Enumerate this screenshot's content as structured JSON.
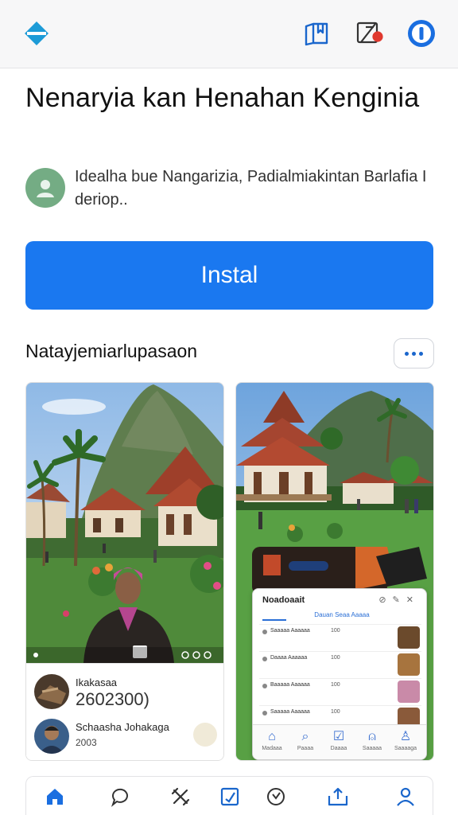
{
  "header": {
    "logo": "diamond-logo-icon",
    "icons": [
      "bookmark-icon",
      "edit-notification-icon",
      "info-icon"
    ]
  },
  "app": {
    "title": "Nenaryia kan Henahan Kenginia",
    "author_text": "Idealha bue Nangarizia, Padialmiakintan Barlafia I deriop..",
    "install_label": "Instal"
  },
  "screenshots": {
    "section_title": "Natayjemiarlupasaon",
    "card1": {
      "row1_name": "Ikakasaa",
      "row1_value": "2602300)",
      "row2_name": "Schaasha Johakaga",
      "row2_sub": "2003"
    },
    "card2": {
      "phone_title": "Noadoaait",
      "phone_tab": "Dauan Seaa Aaaaa",
      "rows": [
        {
          "text": "Saaaaa Aaaaaa",
          "num": "100"
        },
        {
          "text": "Daaaa Aaaaaa",
          "num": "100"
        },
        {
          "text": "Baaaaa Aaaaaa",
          "num": "100"
        },
        {
          "text": "Saaaaa Aaaaaa",
          "num": "100"
        }
      ],
      "nav": [
        "Madaaa",
        "Paaaa",
        "Daaaa",
        "Saaaaa",
        "Saaaaga"
      ]
    }
  },
  "bottom_nav": {
    "items": [
      "home-icon",
      "chat-icon",
      "tools-icon",
      "checklist-icon",
      "smile-icon",
      "share-icon",
      "profile-icon"
    ],
    "active": "home-icon"
  },
  "colors": {
    "accent": "#1a78f0",
    "topbar": "#f7f7f8",
    "avatar": "#74ac84"
  }
}
